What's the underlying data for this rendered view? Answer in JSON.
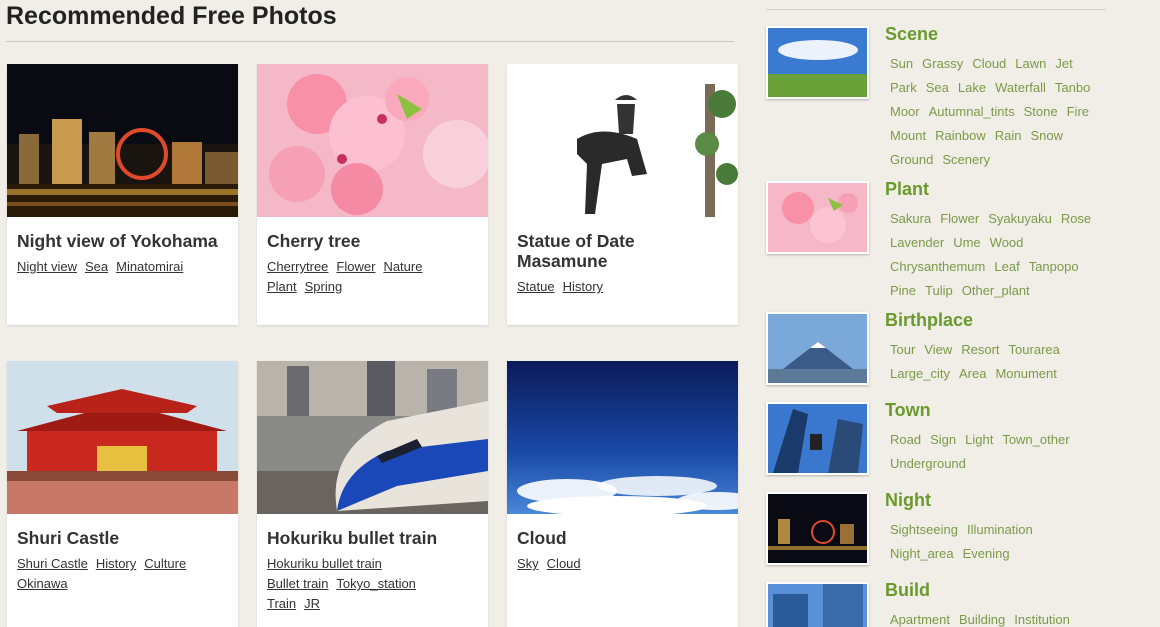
{
  "page_title": "Recommended Free Photos",
  "photos": [
    {
      "title": "Night view of Yokohama",
      "tags": [
        "Night view",
        "Sea",
        "Minatomirai"
      ]
    },
    {
      "title": "Cherry tree",
      "tags": [
        "Cherrytree",
        "Flower",
        "Nature",
        "Plant",
        "Spring"
      ]
    },
    {
      "title": "Statue of Date Masamune",
      "tags": [
        "Statue",
        "History"
      ]
    },
    {
      "title": "Shuri Castle",
      "tags": [
        "Shuri Castle",
        "History",
        "Culture",
        "Okinawa"
      ]
    },
    {
      "title": "Hokuriku bullet train",
      "tags": [
        "Hokuriku bullet train",
        "Bullet train",
        "Tokyo_station",
        "Train",
        "JR"
      ]
    },
    {
      "title": "Cloud",
      "tags": [
        "Sky",
        "Cloud"
      ]
    }
  ],
  "categories": [
    {
      "name": "Scene",
      "tags": [
        "Sun",
        "Grassy",
        "Cloud",
        "Lawn",
        "Jet",
        "Park",
        "Sea",
        "Lake",
        "Waterfall",
        "Tanbo",
        "Moor",
        "Autumnal_tints",
        "Stone",
        "Fire",
        "Mount",
        "Rainbow",
        "Rain",
        "Snow",
        "Ground",
        "Scenery"
      ]
    },
    {
      "name": "Plant",
      "tags": [
        "Sakura",
        "Flower",
        "Syakuyaku",
        "Rose",
        "Lavender",
        "Ume",
        "Wood",
        "Chrysanthemum",
        "Leaf",
        "Tanpopo",
        "Pine",
        "Tulip",
        "Other_plant"
      ]
    },
    {
      "name": "Birthplace",
      "tags": [
        "Tour",
        "View",
        "Resort",
        "Tourarea",
        "Large_city",
        "Area",
        "Monument"
      ]
    },
    {
      "name": "Town",
      "tags": [
        "Road",
        "Sign",
        "Light",
        "Town_other",
        "Underground"
      ]
    },
    {
      "name": "Night",
      "tags": [
        "Sightseeing",
        "Illumination",
        "Night_area",
        "Evening"
      ]
    },
    {
      "name": "Build",
      "tags": [
        "Apartment",
        "Building",
        "Institution"
      ]
    }
  ],
  "colors": {
    "accent": "#6a9a2d",
    "background": "#f1eee7"
  }
}
